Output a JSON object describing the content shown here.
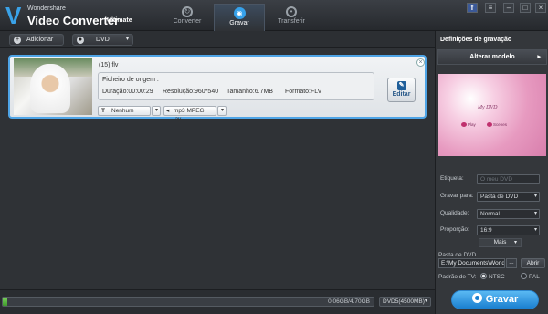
{
  "app": {
    "brand_small": "Wondershare",
    "brand_big": "Video Converter",
    "brand_ultimate": "Ultimate"
  },
  "nav": {
    "converter": "Converter",
    "gravar": "Gravar",
    "transferir": "Transferir"
  },
  "toolbar": {
    "add_label": "Adicionar",
    "dvd_label": "DVD"
  },
  "file": {
    "name": "(15).flv",
    "source_label": "Ficheiro de origem :",
    "duration": "Duração:00:00:29",
    "resolution": "Resolução:960*540",
    "size": "Tamanho:6.7MB",
    "format": "Formato:FLV",
    "edit_label": "Editar",
    "subtitle_option": "Nenhum",
    "audio_option": "mp3 MPEG lay..."
  },
  "capacity": {
    "text": "0.06GB/4.70GB",
    "fill_fraction": 0.013,
    "disc_type": "DVD5(4500MB)"
  },
  "panel": {
    "title": "Definições de gravação",
    "change_model": "Alterar modelo",
    "preview_title": "My DVD",
    "preview_play": "Play",
    "preview_scenes": "Scenes",
    "label_label": "Etiqueta:",
    "label_placeholder": "O meu DVD",
    "burn_to_label": "Gravar para:",
    "burn_to_value": "Pasta de DVD",
    "quality_label": "Qualidade:",
    "quality_value": "Normal",
    "aspect_label": "Proporção:",
    "aspect_value": "16:9",
    "more_label": "Mais",
    "dvd_folder_label": "Pasta de DVD",
    "dvd_path": "E:\\My Documents\\Wonder",
    "browse_label": "...",
    "open_label": "Abrir",
    "tv_standard_label": "Padrão de TV:",
    "tv_ntsc": "NTSC",
    "tv_pal": "PAL",
    "tv_selected": "NTSC",
    "burn_label": "Gravar"
  },
  "colors": {
    "accent": "#36a1ea",
    "selection_border": "#4ea4e6",
    "progress": "#5cbf44"
  }
}
